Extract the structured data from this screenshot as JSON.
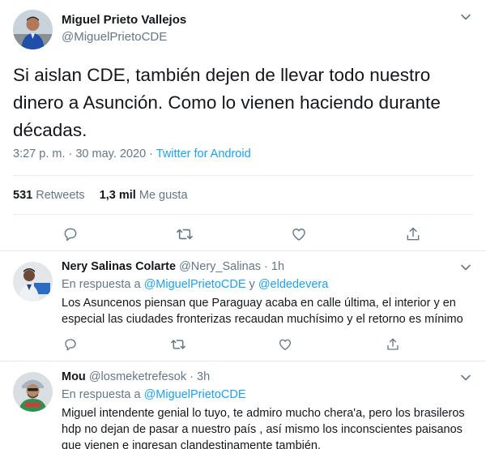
{
  "main": {
    "name": "Miguel Prieto Vallejos",
    "handle": "@MiguelPrietoCDE",
    "text": "Si aislan CDE, también dejen de llevar todo nuestro dinero a Asunción. Como lo vienen haciendo durante décadas.",
    "timestamp": "3:27 p. m. · 30 may. 2020 · ",
    "source": "Twitter for Android",
    "retweets_count": "531",
    "retweets_label": "Retweets",
    "likes_count": "1,3 mil",
    "likes_label": "Me gusta"
  },
  "replies": [
    {
      "name": "Nery Salinas Colarte",
      "handle": "@Nery_Salinas · 1h",
      "in_reply_prefix": "En respuesta a ",
      "mention1": "@MiguelPrietoCDE",
      "joiner": " y ",
      "mention2": "@eldedevera",
      "text": "Los Asuncenos piensan que Paraguay acaba en calle última, el interior y en especial las ciudades fronterizas recaudan muchísimo y el retorno es mínimo"
    },
    {
      "name": "Mou",
      "handle": "@losmeketrefesok · 3h",
      "in_reply_prefix": "En respuesta a ",
      "mention1": "@MiguelPrietoCDE",
      "text": "Miguel intendente genial lo tuyo, te admiro mucho chera'a, pero los brasileros hdp no dejan de pasar a nuestro país , así mismo los inconscientes paisanos que vienen e ingresan clandestinamente también."
    }
  ],
  "icons": {
    "reply": "reply-icon",
    "retweet": "retweet-icon",
    "like": "heart-icon",
    "share": "share-icon",
    "more": "chevron-down-icon"
  },
  "colors": {
    "link": "#1da1f2",
    "secondary_text": "#657786",
    "primary_text": "#14171a",
    "border": "#e6ecf0"
  }
}
